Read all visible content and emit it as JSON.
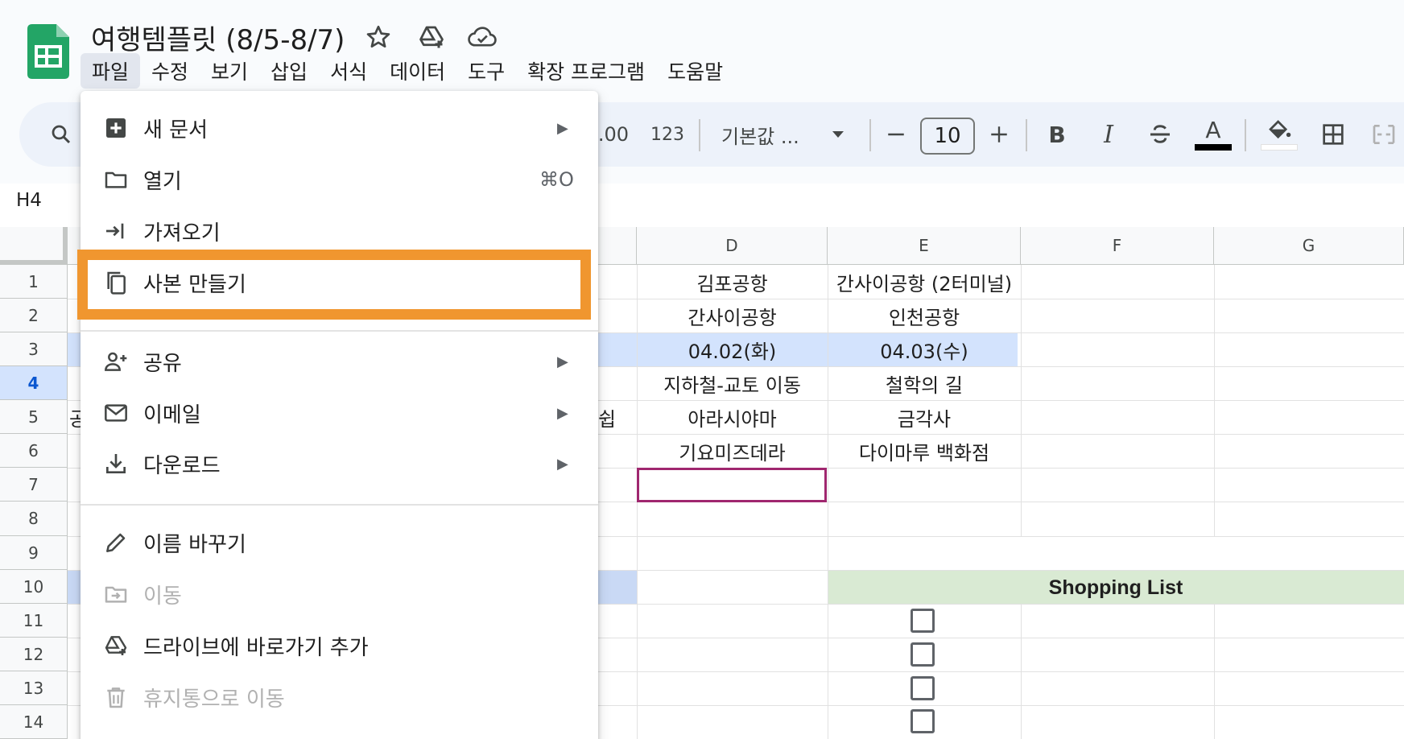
{
  "app": {
    "document_title": "여행템플릿 (8/5-8/7)",
    "title_icons": [
      "star-icon",
      "drive-add-icon",
      "cloud-saved-icon"
    ]
  },
  "menubar": {
    "items": [
      "파일",
      "수정",
      "보기",
      "삽입",
      "서식",
      "데이터",
      "도구",
      "확장 프로그램",
      "도움말"
    ],
    "active_index": 0
  },
  "toolbar": {
    "decimal_label": ".00",
    "number_format_label": "123",
    "font_family": "기본값 ...",
    "font_size": "10",
    "text_color": "#000000",
    "fill_color": "#ffffff"
  },
  "formula_bar": {
    "name_box": "H4"
  },
  "grid": {
    "columns": [
      "D",
      "E",
      "F",
      "G"
    ],
    "rows": [
      "1",
      "2",
      "3",
      "4",
      "5",
      "6",
      "7",
      "8",
      "9",
      "10",
      "11",
      "12",
      "13",
      "14"
    ],
    "active_row": "4",
    "cells": {
      "D1": "김포공항",
      "E1": "간사이공항 (2터미널)",
      "D2": "간사이공항",
      "E2": "인천공항",
      "D3": "04.02(화)",
      "E3": "04.03(수)",
      "D4": "지하철-교토 이동",
      "E4": "철학의 길",
      "D5": "아라시야마",
      "E5": "금각사",
      "D6": "기요미즈데라",
      "E6": "다이마루 백화점",
      "A5_partial": "공",
      "C5_partial": "쉽"
    },
    "shopping_list_title": "Shopping List",
    "header_fill_color": "#d3e3fd",
    "shopping_fill_color": "#d9ead3",
    "selection_color": "#a0276f"
  },
  "file_menu": {
    "items": [
      {
        "label": "새 문서",
        "icon": "new-doc-icon",
        "submenu": true,
        "shortcut": "",
        "disabled": false
      },
      {
        "label": "열기",
        "icon": "folder-icon",
        "submenu": false,
        "shortcut": "⌘O",
        "disabled": false
      },
      {
        "label": "가져오기",
        "icon": "import-icon",
        "submenu": false,
        "shortcut": "",
        "disabled": false
      },
      {
        "label": "사본 만들기",
        "icon": "copy-icon",
        "submenu": false,
        "shortcut": "",
        "disabled": false
      },
      {
        "label": "공유",
        "icon": "share-person-icon",
        "submenu": true,
        "shortcut": "",
        "disabled": false
      },
      {
        "label": "이메일",
        "icon": "email-icon",
        "submenu": true,
        "shortcut": "",
        "disabled": false
      },
      {
        "label": "다운로드",
        "icon": "download-icon",
        "submenu": true,
        "shortcut": "",
        "disabled": false
      },
      {
        "label": "이름 바꾸기",
        "icon": "pencil-icon",
        "submenu": false,
        "shortcut": "",
        "disabled": false
      },
      {
        "label": "이동",
        "icon": "move-folder-icon",
        "submenu": false,
        "shortcut": "",
        "disabled": true
      },
      {
        "label": "드라이브에 바로가기 추가",
        "icon": "drive-shortcut-icon",
        "submenu": false,
        "shortcut": "",
        "disabled": false
      },
      {
        "label": "휴지통으로 이동",
        "icon": "trash-icon",
        "submenu": false,
        "shortcut": "",
        "disabled": true
      }
    ],
    "submenu_arrow": "▶",
    "highlighted_item": "사본 만들기",
    "highlight_color": "#f0962f"
  }
}
